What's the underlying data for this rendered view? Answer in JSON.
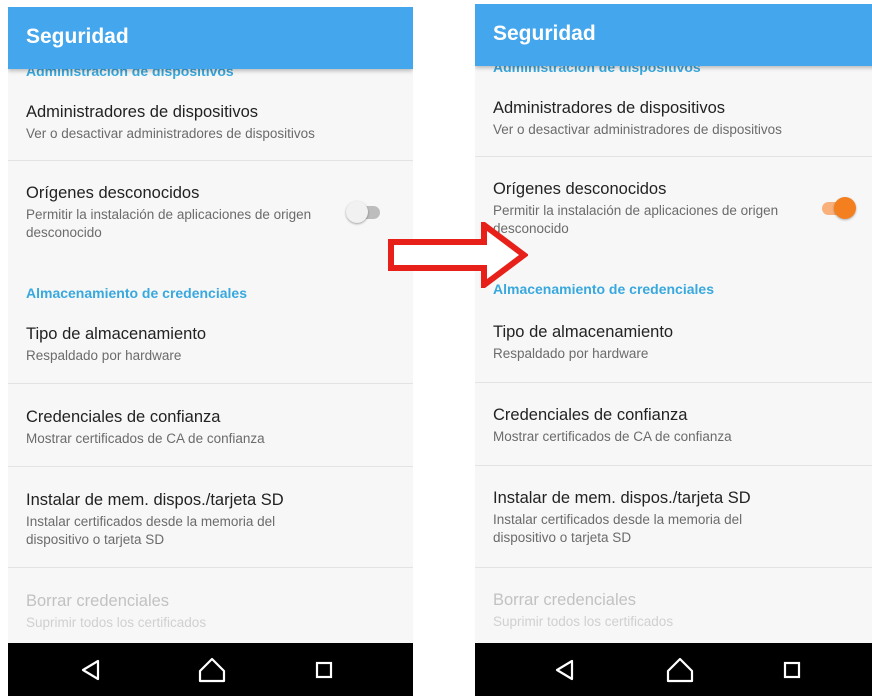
{
  "app_title": "Seguridad",
  "clipped_section": "Administración de dispositivos",
  "items": {
    "device_admins": {
      "title": "Administradores de dispositivos",
      "subtitle": "Ver o desactivar administradores de dispositivos"
    },
    "unknown_sources": {
      "title": "Orígenes desconocidos",
      "subtitle": "Permitir la instalación de aplicaciones de origen desconocido"
    },
    "storage_type": {
      "title": "Tipo de almacenamiento",
      "subtitle": "Respaldado por hardware"
    },
    "trusted_credentials": {
      "title": "Credenciales de confianza",
      "subtitle": "Mostrar certificados de CA de confianza"
    },
    "install_from_storage": {
      "title": "Instalar de mem. dispos./tarjeta SD",
      "subtitle": "Instalar certificados desde la memoria del dispositivo o tarjeta SD"
    },
    "clear_credentials": {
      "title": "Borrar credenciales",
      "subtitle": "Suprimir todos los certificados"
    }
  },
  "section_credentials": "Almacenamiento de credenciales",
  "screens": {
    "before": {
      "unknown_sources_enabled": false
    },
    "after": {
      "unknown_sources_enabled": true
    }
  },
  "nav_icons": [
    "back-icon",
    "home-icon",
    "recents-icon"
  ],
  "colors": {
    "appbar": "#44a6ec",
    "section_header": "#38a8de",
    "toggle_on": "#f37f1f",
    "toggle_off": "#bdbdbd",
    "arrow": "#e8201a"
  }
}
